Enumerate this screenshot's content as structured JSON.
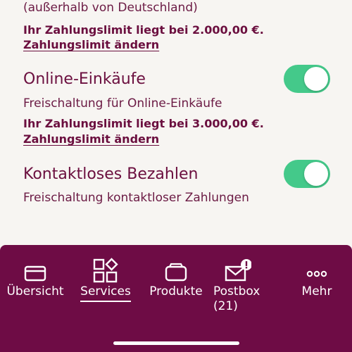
{
  "foreign": {
    "subtitle": "(außerhalb von Deutschland)",
    "limit_text": "Ihr Zahlungslimit liegt bei 2.000,00 €.",
    "change_link": "Zahlungslimit ändern"
  },
  "online": {
    "title": "Online-Einkäufe",
    "subtitle": "Freischaltung für Online-Einkäufe",
    "limit_text": "Ihr Zahlungslimit liegt bei 3.000,00 €.",
    "change_link": "Zahlungslimit ändern",
    "enabled": true
  },
  "contactless": {
    "title": "Kontaktloses Bezahlen",
    "subtitle": "Freischaltung kontaktloser Zahlungen",
    "enabled": true
  },
  "tabbar": {
    "overview": "Übersicht",
    "services": "Services",
    "products": "Produkte",
    "postbox": "Postbox",
    "postbox_count": "(21)",
    "more": "Mehr",
    "active": "Services"
  },
  "colors": {
    "brand": "#6e0c45",
    "toggle_on": "#44c98a",
    "background": "#f7f5f2"
  },
  "icons": [
    "card-icon",
    "services-grid-icon",
    "products-icon",
    "mail-alert-icon",
    "more-dots-icon"
  ]
}
